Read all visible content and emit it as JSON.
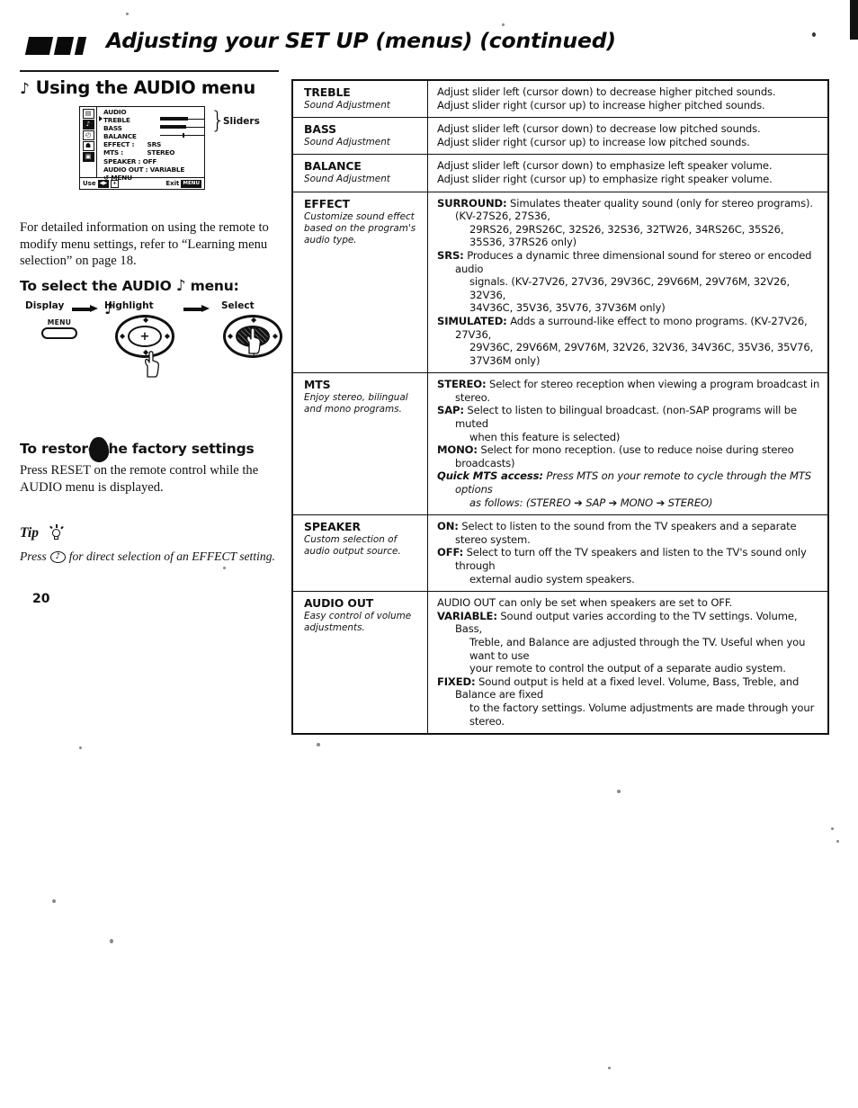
{
  "header": {
    "title": "Adjusting your SET UP (menus) (continued)"
  },
  "left": {
    "section_title": "Using the AUDIO menu",
    "section_note_glyph": "♪",
    "tv_menu": {
      "title": "AUDIO",
      "icons": [
        "tv-icon",
        "music-note-icon",
        "clock-icon",
        "setup-icon",
        "captions-icon"
      ],
      "icon_glyphs": [
        "▤",
        "♪",
        "◴",
        "☗",
        "▣"
      ],
      "rows": [
        {
          "label": "TREBLE",
          "value": "",
          "kind": "slider",
          "cursor": true,
          "fill_pct": 62
        },
        {
          "label": "BASS",
          "value": "",
          "kind": "slider",
          "cursor": false,
          "fill_pct": 58
        },
        {
          "label": "BALANCE",
          "value": "",
          "kind": "slider-center",
          "cursor": false,
          "fill_pct": 50
        },
        {
          "label": "EFFECT :",
          "value": "SRS",
          "kind": "value",
          "cursor": false
        },
        {
          "label": "MTS :",
          "value": "STEREO",
          "kind": "value",
          "cursor": false
        },
        {
          "label": "SPEAKER : OFF",
          "value": "",
          "kind": "value",
          "cursor": false
        },
        {
          "label": "AUDIO OUT : VARIABLE",
          "value": "",
          "kind": "value",
          "cursor": false
        },
        {
          "label": "↺ MENU",
          "value": "",
          "kind": "value",
          "cursor": false
        }
      ],
      "footer": {
        "use_label": "Use",
        "use_key1": "◀▶",
        "use_key2": "+",
        "exit_label": "Exit",
        "exit_key": "MENU"
      },
      "sliders_brace": "}",
      "sliders_label": "Sliders"
    },
    "intro_paragraph": "For detailed information on using the remote to modify menu settings, refer to “Learning menu selection” on page 18.",
    "select_heading_pre": "To select the AUDIO",
    "select_heading_glyph": "♪",
    "select_heading_post": "menu:",
    "steps": {
      "display_label": "Display",
      "highlight_label": "Highlight",
      "highlight_glyph": "♪",
      "select_label": "Select",
      "menu_button_caption": "MENU",
      "joypad_plus": "+"
    },
    "restore_heading": "To restore the factory settings",
    "restore_paragraph": "Press RESET on the remote control while the AUDIO menu is displayed.",
    "tip_word": "Tip",
    "tip_text_pre": "Press",
    "tip_button_glyph": "♪",
    "tip_text_post": "for direct selection of an EFFECT setting.",
    "page_number": "20"
  },
  "table": {
    "rows": [
      {
        "name": "TREBLE",
        "subtitle": "Sound Adjustment",
        "lines": [
          {
            "text": "Adjust slider left (cursor down) to decrease higher pitched sounds."
          },
          {
            "text": "Adjust slider right (cursor up) to increase higher pitched sounds."
          }
        ]
      },
      {
        "name": "BASS",
        "subtitle": "Sound Adjustment",
        "lines": [
          {
            "text": "Adjust slider left (cursor down) to decrease low pitched sounds."
          },
          {
            "text": "Adjust slider right (cursor up) to increase low pitched sounds."
          }
        ]
      },
      {
        "name": "BALANCE",
        "subtitle": "Sound Adjustment",
        "lines": [
          {
            "text": "Adjust slider left (cursor down) to emphasize left speaker volume."
          },
          {
            "text": "Adjust slider right (cursor up) to emphasize right speaker volume."
          }
        ]
      },
      {
        "name": "EFFECT",
        "subtitle": "Customize sound effect based on the program's audio type.",
        "lines": [
          {
            "bold": "SURROUND:",
            "text": " Simulates theater quality sound (only for stereo programs). (KV-27S26, 27S36,",
            "style": "ind"
          },
          {
            "text": "29RS26, 29RS26C, 32S26, 32S36, 32TW26, 34RS26C, 35S26, 35S36, 37RS26 only)",
            "style": "ind2"
          },
          {
            "bold": "SRS:",
            "text": "  Produces a dynamic three dimensional sound for stereo or encoded  audio",
            "style": "ind"
          },
          {
            "text": "signals. (KV-27V26, 27V36, 29V36C, 29V66M, 29V76M, 32V26, 32V36,",
            "style": "ind2"
          },
          {
            "text": "34V36C, 35V36, 35V76, 37V36M only)",
            "style": "ind2"
          },
          {
            "bold": "SIMULATED:",
            "text": "  Adds a surround-like effect to mono programs. (KV-27V26, 27V36,",
            "style": "ind"
          },
          {
            "text": "29V36C, 29V66M, 29V76M, 32V26, 32V36, 34V36C, 35V36, 35V76, 37V36M only)",
            "style": "ind2"
          }
        ]
      },
      {
        "name": "MTS",
        "subtitle": "Enjoy stereo, bilingual and mono programs.",
        "lines": [
          {
            "bold": "STEREO:",
            "text": "  Select for stereo reception when viewing a program broadcast in stereo.",
            "style": "ind"
          },
          {
            "bold": "SAP:",
            "text": "  Select to listen to bilingual broadcast. (non-SAP programs will be muted",
            "style": "ind"
          },
          {
            "text": "when this feature is selected)",
            "style": "ind2"
          },
          {
            "bold": "MONO:",
            "text": "  Select for mono reception. (use to reduce noise during stereo broadcasts)",
            "style": "ind"
          },
          {
            "bolditalic": "Quick MTS access:",
            "text": " Press MTS on your remote to cycle through the MTS options",
            "style": "ind ital"
          },
          {
            "text": "as follows: (STEREO ➔ SAP ➔ MONO ➔ STEREO)",
            "style": "ind2 ital"
          }
        ]
      },
      {
        "name": "SPEAKER",
        "subtitle": "Custom selection of audio output source.",
        "lines": [
          {
            "bold": "ON:",
            "text": "  Select to listen to the sound from the TV speakers and a separate stereo system.",
            "style": "ind"
          },
          {
            "bold": "OFF:",
            "text": "  Select to turn off the TV speakers and listen to the TV's sound only through",
            "style": "ind"
          },
          {
            "text": "external audio system speakers.",
            "style": "ind2"
          }
        ]
      },
      {
        "name": "AUDIO OUT",
        "subtitle": "Easy control of volume adjustments.",
        "lines": [
          {
            "text": "AUDIO OUT can only be set when speakers are set to OFF.",
            "style": "ind"
          },
          {
            "bold": "VARIABLE:",
            "text": "  Sound output varies according to the TV settings. Volume, Bass,",
            "style": "ind"
          },
          {
            "text": "Treble, and Balance are adjusted through the TV. Useful when you want to use",
            "style": "ind2"
          },
          {
            "text": "your remote to control the output of a separate audio system.",
            "style": "ind2"
          },
          {
            "bold": "FIXED:",
            "text": "  Sound output is held at a fixed level. Volume, Bass, Treble, and Balance  are fixed",
            "style": "ind"
          },
          {
            "text": "to the factory settings. Volume adjustments are made through your stereo.",
            "style": "ind2"
          }
        ]
      }
    ]
  },
  "colors": {
    "ink": "#0a0a0a",
    "paper": "#ffffff"
  }
}
